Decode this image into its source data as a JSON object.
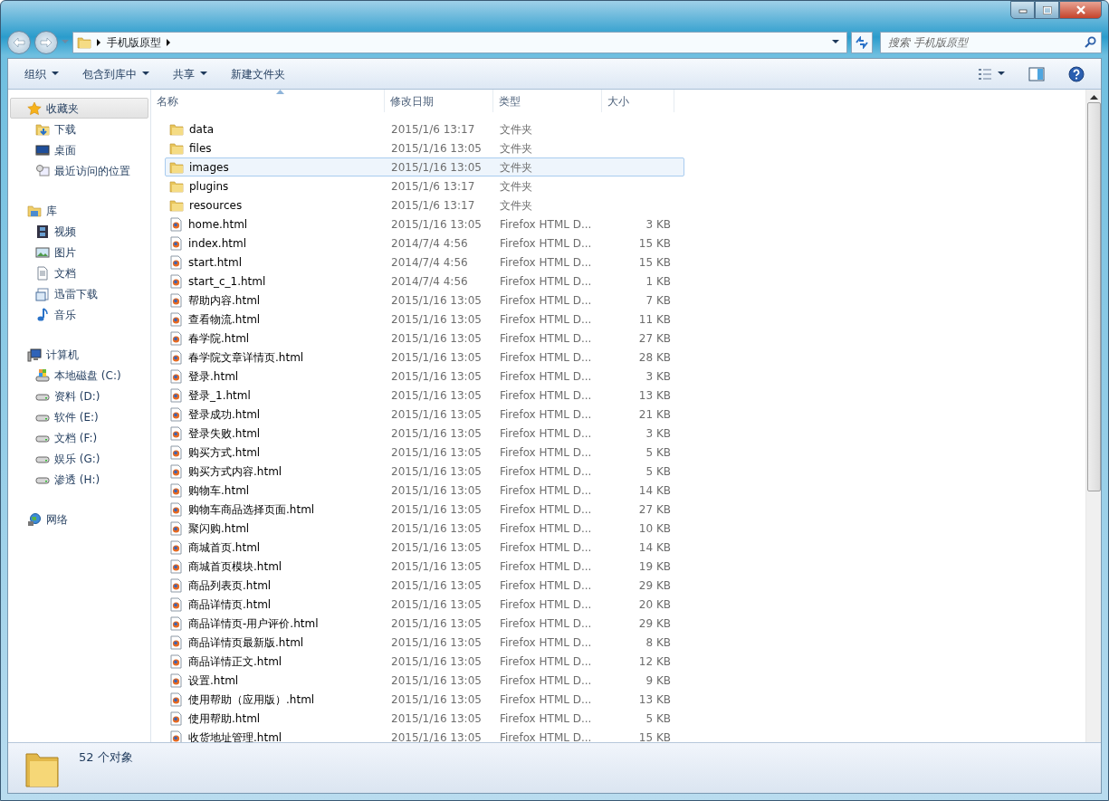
{
  "address": {
    "path": "手机版原型",
    "search_placeholder": "搜索 手机版原型"
  },
  "toolbar": {
    "buttons": [
      {
        "label": "组织",
        "dropdown": true
      },
      {
        "label": "包含到库中",
        "dropdown": true
      },
      {
        "label": "共享",
        "dropdown": true
      },
      {
        "label": "新建文件夹",
        "dropdown": false
      }
    ]
  },
  "sidebar": {
    "groups": [
      {
        "label": "收藏夹",
        "kind": "favorites",
        "selected": true,
        "items": [
          {
            "label": "下载",
            "kind": "download"
          },
          {
            "label": "桌面",
            "kind": "desktop"
          },
          {
            "label": "最近访问的位置",
            "kind": "recent"
          }
        ]
      },
      {
        "label": "库",
        "kind": "library",
        "selected": false,
        "items": [
          {
            "label": "视频",
            "kind": "video"
          },
          {
            "label": "图片",
            "kind": "picture"
          },
          {
            "label": "文档",
            "kind": "document"
          },
          {
            "label": "迅雷下载",
            "kind": "library-folder"
          },
          {
            "label": "音乐",
            "kind": "music"
          }
        ]
      },
      {
        "label": "计算机",
        "kind": "computer",
        "selected": false,
        "items": [
          {
            "label": "本地磁盘 (C:)",
            "kind": "system-drive"
          },
          {
            "label": "资料 (D:)",
            "kind": "drive"
          },
          {
            "label": "软件 (E:)",
            "kind": "drive"
          },
          {
            "label": "文档 (F:)",
            "kind": "drive"
          },
          {
            "label": "娱乐 (G:)",
            "kind": "drive"
          },
          {
            "label": "渗透 (H:)",
            "kind": "drive"
          }
        ]
      },
      {
        "label": "网络",
        "kind": "network",
        "selected": false
      }
    ]
  },
  "table": {
    "columns": [
      "名称",
      "修改日期",
      "类型",
      "大小"
    ],
    "rows": [
      {
        "kind": "folder",
        "name": "data",
        "date": "2015/1/6 13:17",
        "type": "文件夹",
        "size": "",
        "selected": false
      },
      {
        "kind": "folder",
        "name": "files",
        "date": "2015/1/16 13:05",
        "type": "文件夹",
        "size": "",
        "selected": false
      },
      {
        "kind": "folder",
        "name": "images",
        "date": "2015/1/16 13:05",
        "type": "文件夹",
        "size": "",
        "selected": true
      },
      {
        "kind": "folder",
        "name": "plugins",
        "date": "2015/1/6 13:17",
        "type": "文件夹",
        "size": "",
        "selected": false
      },
      {
        "kind": "folder",
        "name": "resources",
        "date": "2015/1/6 13:17",
        "type": "文件夹",
        "size": "",
        "selected": false
      },
      {
        "kind": "file",
        "name": "home.html",
        "date": "2015/1/16 13:05",
        "type": "Firefox HTML D...",
        "size": "3 KB",
        "selected": false
      },
      {
        "kind": "file",
        "name": "index.html",
        "date": "2014/7/4 4:56",
        "type": "Firefox HTML D...",
        "size": "15 KB",
        "selected": false
      },
      {
        "kind": "file",
        "name": "start.html",
        "date": "2014/7/4 4:56",
        "type": "Firefox HTML D...",
        "size": "15 KB",
        "selected": false
      },
      {
        "kind": "file",
        "name": "start_c_1.html",
        "date": "2014/7/4 4:56",
        "type": "Firefox HTML D...",
        "size": "1 KB",
        "selected": false
      },
      {
        "kind": "file",
        "name": "帮助内容.html",
        "date": "2015/1/16 13:05",
        "type": "Firefox HTML D...",
        "size": "7 KB",
        "selected": false
      },
      {
        "kind": "file",
        "name": "查看物流.html",
        "date": "2015/1/16 13:05",
        "type": "Firefox HTML D...",
        "size": "11 KB",
        "selected": false
      },
      {
        "kind": "file",
        "name": "春学院.html",
        "date": "2015/1/16 13:05",
        "type": "Firefox HTML D...",
        "size": "27 KB",
        "selected": false
      },
      {
        "kind": "file",
        "name": "春学院文章详情页.html",
        "date": "2015/1/16 13:05",
        "type": "Firefox HTML D...",
        "size": "28 KB",
        "selected": false
      },
      {
        "kind": "file",
        "name": "登录.html",
        "date": "2015/1/16 13:05",
        "type": "Firefox HTML D...",
        "size": "3 KB",
        "selected": false
      },
      {
        "kind": "file",
        "name": "登录_1.html",
        "date": "2015/1/16 13:05",
        "type": "Firefox HTML D...",
        "size": "13 KB",
        "selected": false
      },
      {
        "kind": "file",
        "name": "登录成功.html",
        "date": "2015/1/16 13:05",
        "type": "Firefox HTML D...",
        "size": "21 KB",
        "selected": false
      },
      {
        "kind": "file",
        "name": "登录失败.html",
        "date": "2015/1/16 13:05",
        "type": "Firefox HTML D...",
        "size": "3 KB",
        "selected": false
      },
      {
        "kind": "file",
        "name": "购买方式.html",
        "date": "2015/1/16 13:05",
        "type": "Firefox HTML D...",
        "size": "5 KB",
        "selected": false
      },
      {
        "kind": "file",
        "name": "购买方式内容.html",
        "date": "2015/1/16 13:05",
        "type": "Firefox HTML D...",
        "size": "5 KB",
        "selected": false
      },
      {
        "kind": "file",
        "name": "购物车.html",
        "date": "2015/1/16 13:05",
        "type": "Firefox HTML D...",
        "size": "14 KB",
        "selected": false
      },
      {
        "kind": "file",
        "name": "购物车商品选择页面.html",
        "date": "2015/1/16 13:05",
        "type": "Firefox HTML D...",
        "size": "27 KB",
        "selected": false
      },
      {
        "kind": "file",
        "name": "聚闪购.html",
        "date": "2015/1/16 13:05",
        "type": "Firefox HTML D...",
        "size": "10 KB",
        "selected": false
      },
      {
        "kind": "file",
        "name": "商城首页.html",
        "date": "2015/1/16 13:05",
        "type": "Firefox HTML D...",
        "size": "14 KB",
        "selected": false
      },
      {
        "kind": "file",
        "name": "商城首页模块.html",
        "date": "2015/1/16 13:05",
        "type": "Firefox HTML D...",
        "size": "19 KB",
        "selected": false
      },
      {
        "kind": "file",
        "name": "商品列表页.html",
        "date": "2015/1/16 13:05",
        "type": "Firefox HTML D...",
        "size": "29 KB",
        "selected": false
      },
      {
        "kind": "file",
        "name": "商品详情页.html",
        "date": "2015/1/16 13:05",
        "type": "Firefox HTML D...",
        "size": "20 KB",
        "selected": false
      },
      {
        "kind": "file",
        "name": "商品详情页-用户评价.html",
        "date": "2015/1/16 13:05",
        "type": "Firefox HTML D...",
        "size": "29 KB",
        "selected": false
      },
      {
        "kind": "file",
        "name": "商品详情页最新版.html",
        "date": "2015/1/16 13:05",
        "type": "Firefox HTML D...",
        "size": "8 KB",
        "selected": false
      },
      {
        "kind": "file",
        "name": "商品详情正文.html",
        "date": "2015/1/16 13:05",
        "type": "Firefox HTML D...",
        "size": "12 KB",
        "selected": false
      },
      {
        "kind": "file",
        "name": "设置.html",
        "date": "2015/1/16 13:05",
        "type": "Firefox HTML D...",
        "size": "9 KB",
        "selected": false
      },
      {
        "kind": "file",
        "name": "使用帮助（应用版）.html",
        "date": "2015/1/16 13:05",
        "type": "Firefox HTML D...",
        "size": "13 KB",
        "selected": false
      },
      {
        "kind": "file",
        "name": "使用帮助.html",
        "date": "2015/1/16 13:05",
        "type": "Firefox HTML D...",
        "size": "5 KB",
        "selected": false
      },
      {
        "kind": "file",
        "name": "收货地址管理.html",
        "date": "2015/1/16 13:05",
        "type": "Firefox HTML D...",
        "size": "15 KB",
        "selected": false
      }
    ]
  },
  "status_bar": {
    "text": "52 个对象"
  }
}
